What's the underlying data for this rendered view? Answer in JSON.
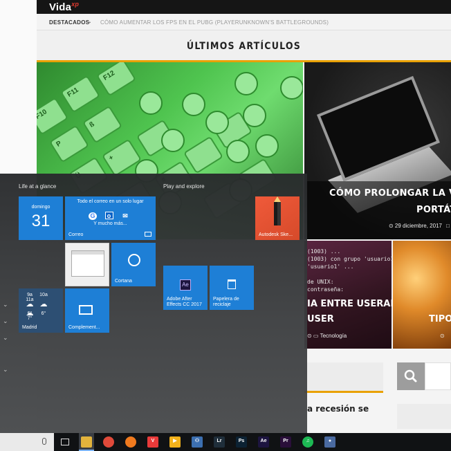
{
  "site": {
    "logo": "Vida",
    "logo_suffix": "xp",
    "crumb_label": "DESTACADOS",
    "crumb_arrow": "→",
    "ticker": "CÓMO AUMENTAR LOS FPS EN EL PUBG (PLAYERUNKNOWN'S BATTLEGROUNDS)",
    "latest_title": "ÚLTIMOS ARTÍCULOS",
    "card_b": {
      "title_line1": "CÓMO PROLONGAR LA VIDA",
      "title_line2": "PORTÁT",
      "date": "⊙ 29 diciembre, 2017",
      "meta_tail": "□"
    },
    "card_c": {
      "terminal": "(1003) ...\n(1003) con grupo 'usuario1\n'usuario1' ...\n\nde UNIX:\ncontraseña:",
      "title_line1": "IA ENTRE USERADD",
      "title_line2": "USER",
      "meta": "⊙    ▭ Tecnología"
    },
    "card_d": {
      "title": "TIPOS",
      "meta": "⊙"
    },
    "snippet": "a recesión se",
    "accent": "#e9a100"
  },
  "start_menu": {
    "group_left": "Life at a glance",
    "group_right": "Play and explore",
    "rail_chevrons": [
      "⌄",
      "⌄",
      "⌄",
      "⌄"
    ],
    "calendar": {
      "day": "domingo",
      "date": "31"
    },
    "mail": {
      "headline": "Todo el correo en un solo lugar",
      "icons": [
        "G",
        "o",
        "✉"
      ],
      "more": "Y mucho más...",
      "label": "Correo"
    },
    "cortana_label": "Cortana",
    "weather": {
      "times": [
        "9a",
        "10a",
        "11a"
      ],
      "icons": [
        "☁",
        "☁",
        "☁"
      ],
      "temps": [
        "6°",
        "6°",
        "7°"
      ],
      "label": "Madrid"
    },
    "complement_label": "Complement...",
    "after_effects": {
      "glyph": "Ae",
      "label_line1": "Adobe After",
      "label_line2": "Effects CC 2017"
    },
    "recycle": {
      "label_line1": "Papelera de",
      "label_line2": "reciclaje"
    },
    "sketchbook_label": "Autodesk Ske..."
  },
  "taskbar": {
    "icons": [
      {
        "name": "file-explorer-icon",
        "glyph": "",
        "bg": "#e2b33c"
      },
      {
        "name": "chrome-icon",
        "glyph": "",
        "bg": "#e04a3a"
      },
      {
        "name": "firefox-icon",
        "glyph": "",
        "bg": "#f07a1e"
      },
      {
        "name": "vivaldi-icon",
        "glyph": "V",
        "bg": "#e83a3a"
      },
      {
        "name": "media-player-icon",
        "glyph": "▶",
        "bg": "#f3b21c"
      },
      {
        "name": "network-app-icon",
        "glyph": "⚇",
        "bg": "#3c6fb0"
      },
      {
        "name": "lightroom-icon",
        "glyph": "Lr",
        "bg": "#1f2e3a"
      },
      {
        "name": "photoshop-icon",
        "glyph": "Ps",
        "bg": "#0c2233"
      },
      {
        "name": "after-effects-icon",
        "glyph": "Ae",
        "bg": "#1d1540"
      },
      {
        "name": "premiere-icon",
        "glyph": "Pr",
        "bg": "#2a0f3a"
      },
      {
        "name": "spotify-icon",
        "glyph": "♫",
        "bg": "#1db954"
      },
      {
        "name": "vpn-icon",
        "glyph": "●",
        "bg": "#4a6aa0"
      }
    ],
    "tile_color": "#1e7fd6"
  }
}
